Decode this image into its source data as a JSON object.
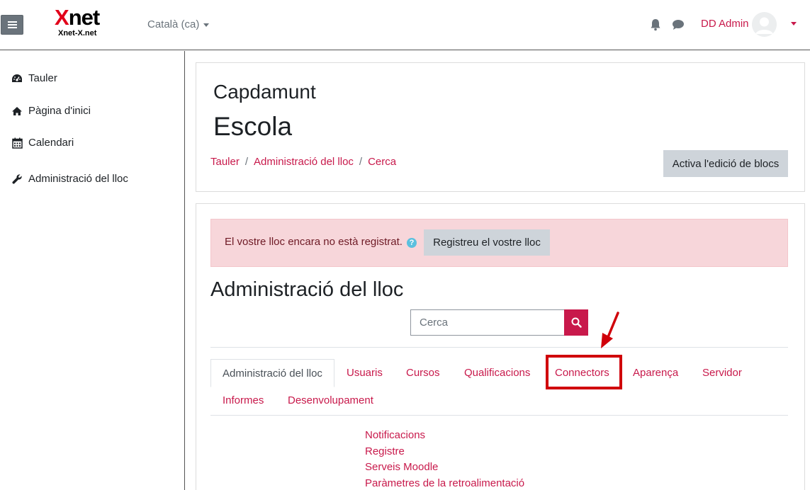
{
  "navbar": {
    "logo_big_x": "X",
    "logo_big_rest": "net",
    "logo_small": "Xnet-X.net",
    "language": "Català (ca)",
    "user_name": "DD Admin"
  },
  "sidebar": {
    "items": [
      {
        "label": "Tauler",
        "icon": "dashboard-icon"
      },
      {
        "label": "Pàgina d'inici",
        "icon": "home-icon"
      },
      {
        "label": "Calendari",
        "icon": "calendar-icon"
      },
      {
        "label": "Administració del lloc",
        "icon": "wrench-icon"
      }
    ]
  },
  "header": {
    "site_name_line1": "Capdamunt",
    "site_name_line2": "Escola",
    "breadcrumb": [
      "Tauler",
      "Administració del lloc",
      "Cerca"
    ],
    "breadcrumb_separator": "/",
    "edit_button": "Activa l'edició de blocs"
  },
  "main": {
    "alert_text": "El vostre lloc encara no està registrat.",
    "help_icon": "?",
    "register_button": "Registreu el vostre lloc",
    "heading": "Administració del lloc",
    "search_placeholder": "Cerca",
    "tabs": [
      {
        "label": "Administració del lloc",
        "active": true
      },
      {
        "label": "Usuaris"
      },
      {
        "label": "Cursos"
      },
      {
        "label": "Qualificacions"
      },
      {
        "label": "Connectors",
        "highlighted": true
      },
      {
        "label": "Aparença"
      },
      {
        "label": "Servidor"
      },
      {
        "label": "Informes"
      },
      {
        "label": "Desenvolupament"
      }
    ],
    "links": [
      "Notificacions",
      "Registre",
      "Serveis Moodle",
      "Paràmetres de la retroalimentació"
    ]
  },
  "colors": {
    "accent": "#c8194b",
    "alert_bg": "#f7d6da",
    "highlight": "#d0000a",
    "button_grey": "#ced4da"
  }
}
